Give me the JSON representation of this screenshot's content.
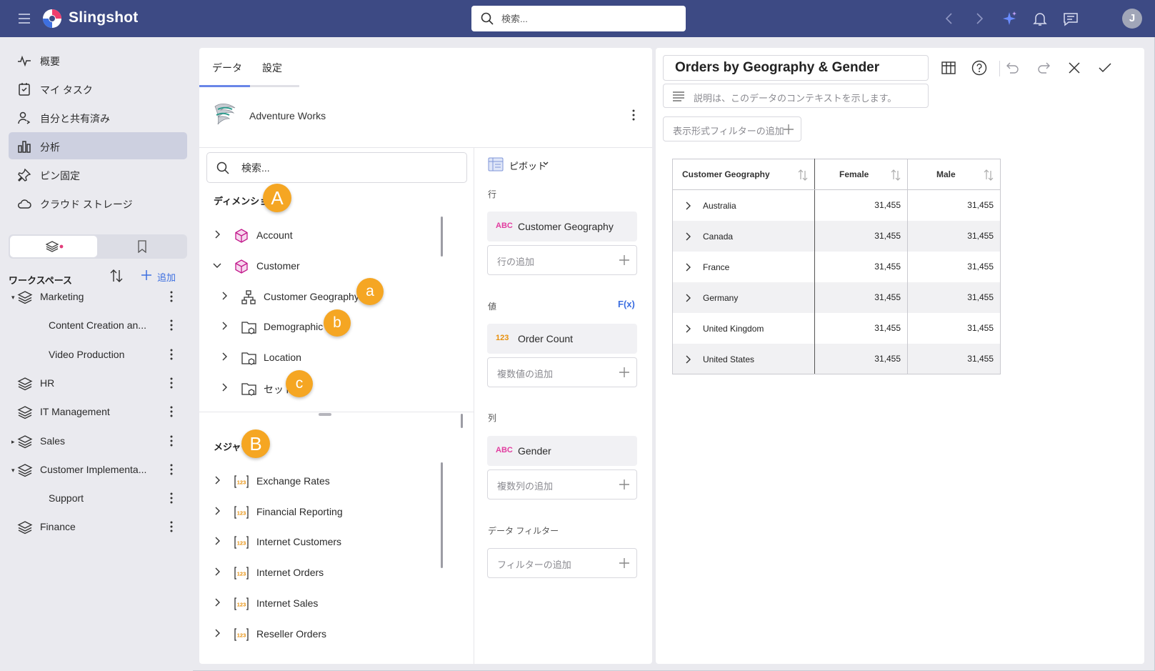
{
  "app": {
    "name": "Slingshot"
  },
  "topbar": {
    "search_placeholder": "検索...",
    "avatar_initial": "J",
    "colors": {
      "bar": "#3d4a84",
      "accent": "#3d6fe0"
    }
  },
  "nav": {
    "items": [
      {
        "label": "概要",
        "icon": "activity-icon"
      },
      {
        "label": "マイ タスク",
        "icon": "task-icon"
      },
      {
        "label": "自分と共有済み",
        "icon": "shared-user-icon"
      },
      {
        "label": "分析",
        "icon": "bar-chart-icon",
        "active": true
      },
      {
        "label": "ピン固定",
        "icon": "pin-icon"
      },
      {
        "label": "クラウド ストレージ",
        "icon": "cloud-icon"
      }
    ],
    "workspaces_title": "ワークスペース",
    "add_label": "追加",
    "workspaces": [
      {
        "label": "Marketing",
        "caret": "▾",
        "child": false
      },
      {
        "label": "Content Creation an...",
        "child": true
      },
      {
        "label": "Video Production",
        "child": true
      },
      {
        "label": "HR",
        "caret": "",
        "child": false
      },
      {
        "label": "IT Management",
        "caret": "",
        "child": false
      },
      {
        "label": "Sales",
        "caret": "▸",
        "child": false
      },
      {
        "label": "Customer Implementa...",
        "caret": "▾",
        "child": false
      },
      {
        "label": "Support",
        "child": true
      },
      {
        "label": "Finance",
        "caret": "",
        "child": false
      }
    ]
  },
  "data_panel": {
    "tabs": [
      "データ",
      "設定"
    ],
    "active_tab": 0,
    "source_name": "Adventure Works",
    "search_placeholder": "検索...",
    "dimensions_title": "ディメンション",
    "dimensions_badge": "A",
    "dimensions": [
      {
        "label": "Account",
        "icon": "cube-icon",
        "expanded": false
      },
      {
        "label": "Customer",
        "icon": "cube-icon",
        "expanded": true
      },
      {
        "label": "Customer Geography",
        "icon": "hierarchy-icon",
        "badge": "a"
      },
      {
        "label": "Demographic",
        "icon": "folder-icon",
        "badge": "b"
      },
      {
        "label": "Location",
        "icon": "folder-icon"
      },
      {
        "label": "セット",
        "icon": "folder-icon",
        "badge": "c"
      }
    ],
    "measures_title": "メジャー",
    "measures_badge": "B",
    "measures": [
      "Exchange Rates",
      "Financial Reporting",
      "Internet Customers",
      "Internet Orders",
      "Internet Sales",
      "Reseller Orders"
    ]
  },
  "pivot": {
    "title": "ピボット",
    "rows_caption": "行",
    "row_field": {
      "type": "ABC",
      "label": "Customer Geography"
    },
    "add_row": "行の追加",
    "values_caption": "値",
    "fx_label": "F(x)",
    "value_field": {
      "type": "123",
      "label": "Order Count"
    },
    "add_values": "複数値の追加",
    "columns_caption": "列",
    "column_field": {
      "type": "ABC",
      "label": "Gender"
    },
    "add_columns": "複数列の追加",
    "filters_caption": "データ フィルター",
    "add_filter": "フィルターの追加"
  },
  "viz": {
    "title": "Orders by Geography & Gender",
    "description_placeholder": "説明は、このデータのコンテキストを示します。",
    "filter_label": "表示形式フィルターの追加"
  },
  "chart_data": {
    "type": "table",
    "columns": [
      "Customer Geography",
      "Female",
      "Male"
    ],
    "rows": [
      [
        "Australia",
        "31,455",
        "31,455"
      ],
      [
        "Canada",
        "31,455",
        "31,455"
      ],
      [
        "France",
        "31,455",
        "31,455"
      ],
      [
        "Germany",
        "31,455",
        "31,455"
      ],
      [
        "United Kingdom",
        "31,455",
        "31,455"
      ],
      [
        "United States",
        "31,455",
        "31,455"
      ]
    ]
  }
}
